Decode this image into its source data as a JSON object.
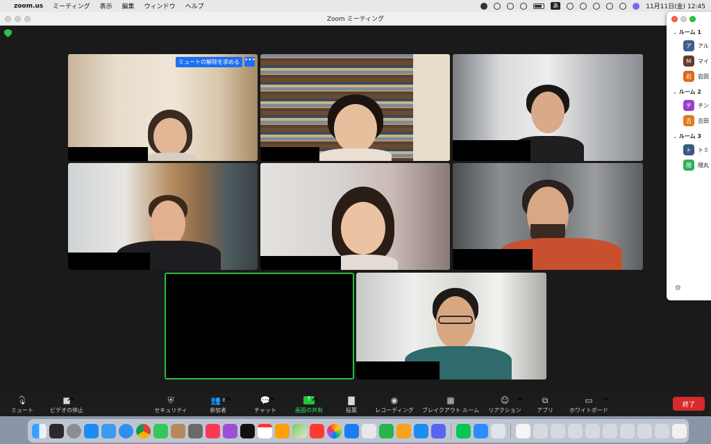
{
  "menubar": {
    "app_name": "zoom.us",
    "menus": [
      "ミーティング",
      "表示",
      "編集",
      "ウィンドウ",
      "ヘルプ"
    ],
    "input_method": "あ",
    "clock": "11月11日(金)  12:45"
  },
  "window": {
    "title": "Zoom ミーティング"
  },
  "tiles": {
    "unmute_request_label": "ミュートの解除を求める",
    "more_label": "•••"
  },
  "toolbar": {
    "mute_label": "ミュート",
    "video_label": "ビデオの停止",
    "security_label": "セキュリティ",
    "participants_label": "参加者",
    "participants_count": "8",
    "chat_label": "チャット",
    "share_label": "画面の共有",
    "poll_label": "投票",
    "record_label": "レコーディング",
    "breakout_label": "ブレイクアウト ルーム",
    "reactions_label": "リアクション",
    "apps_label": "アプリ",
    "whiteboard_label": "ホワイトボード",
    "end_label": "終了"
  },
  "rooms": [
    {
      "name": "ルーム 1",
      "members": [
        {
          "initial": "ア",
          "name": "アル",
          "color": "#3f5f8a"
        },
        {
          "initial": "M",
          "name": "マイ",
          "color": "#6b3a2e"
        },
        {
          "initial": "岩",
          "name": "岩田",
          "color": "#e06a1a"
        }
      ]
    },
    {
      "name": "ルーム 2",
      "members": [
        {
          "initial": "チ",
          "name": "チン",
          "color": "#9b3fc9"
        },
        {
          "initial": "吉",
          "name": "吉田",
          "color": "#e07a1a"
        }
      ]
    },
    {
      "name": "ルーム 3",
      "members": [
        {
          "initial": "ト",
          "name": "トミ",
          "color": "#3a5a80"
        },
        {
          "initial": "隈",
          "name": "隈丸",
          "color": "#2fae5a"
        }
      ]
    }
  ],
  "colors": {
    "share_green": "#23c23e",
    "end_red": "#d8292b",
    "active_border": "#27c23f",
    "badge_blue": "#1d6ff2"
  }
}
